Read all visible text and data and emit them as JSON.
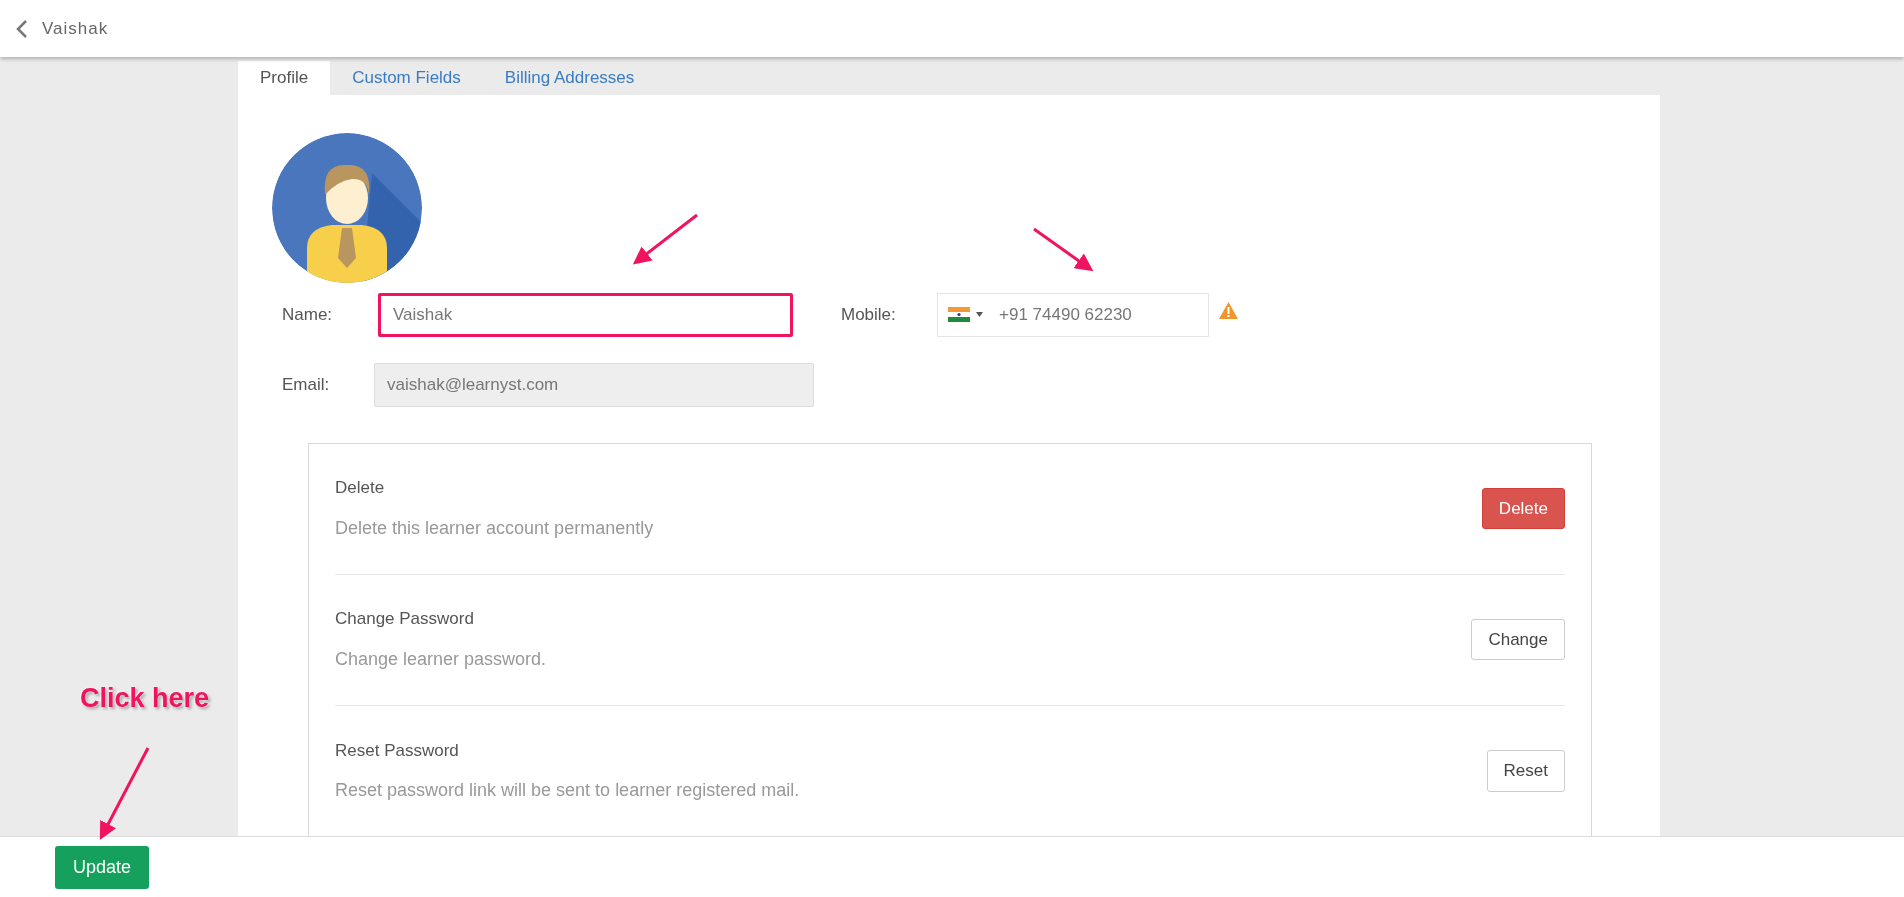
{
  "header": {
    "title": "Vaishak"
  },
  "tabs": [
    {
      "label": "Profile",
      "selected": true
    },
    {
      "label": "Custom Fields",
      "selected": false
    },
    {
      "label": "Billing Addresses",
      "selected": false
    }
  ],
  "form_rows": [
    [
      {
        "label": "Name:",
        "kind": "text",
        "value": "Vaishak",
        "highlighted": true,
        "disabled": false
      },
      {
        "label": "Mobile:",
        "kind": "phone",
        "value": "+91 74490 62230",
        "warning": true
      }
    ],
    [
      {
        "label": "Email:",
        "kind": "text",
        "value": "vaishak@learnyst.com",
        "highlighted": false,
        "disabled": true
      }
    ]
  ],
  "actions": [
    {
      "title": "Delete",
      "description": "Delete this learner account permanently",
      "button": "Delete",
      "kind": "danger"
    },
    {
      "title": "Change Password",
      "description": "Change learner password.",
      "button": "Change",
      "kind": "default"
    },
    {
      "title": "Reset Password",
      "description": "Reset password link will be sent to learner registered mail.",
      "button": "Reset",
      "kind": "default"
    }
  ],
  "footer": {
    "button": "Update"
  },
  "callout": "Click here"
}
